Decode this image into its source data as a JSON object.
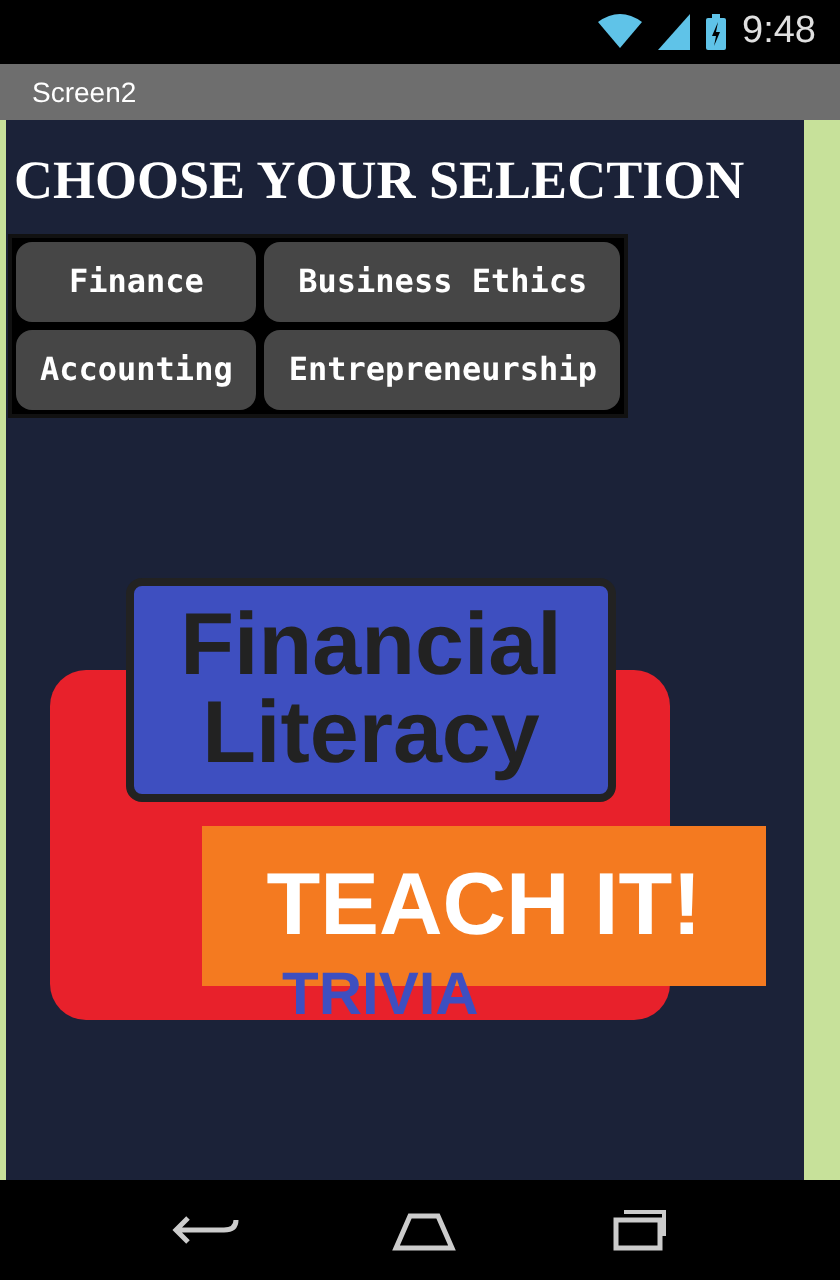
{
  "status_bar": {
    "time": "9:48"
  },
  "window": {
    "title": "Screen2"
  },
  "heading": "CHOOSE YOUR SELECTION",
  "buttons": [
    "Finance",
    "Business Ethics",
    "Accounting",
    "Entrepreneurship"
  ],
  "logo": {
    "line_1": "Financial",
    "line_2": "Literacy",
    "banner": "TEACH IT!",
    "subtitle": "TRIVIA"
  }
}
